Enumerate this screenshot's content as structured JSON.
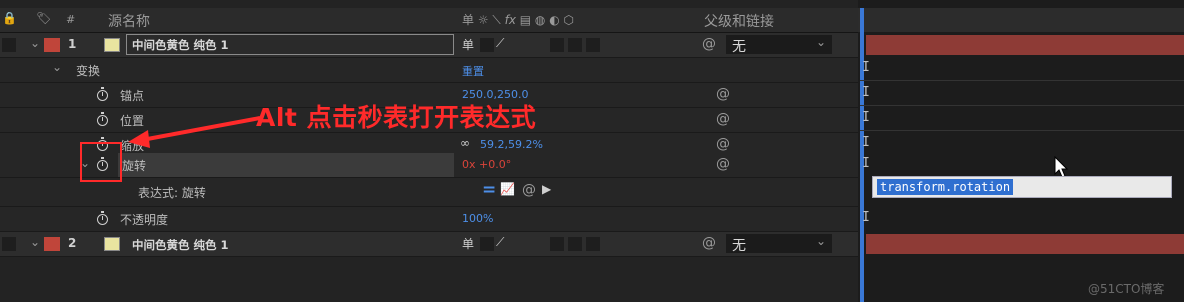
{
  "header": {
    "num_col": "#",
    "source_name_col": "源名称",
    "parent_col": "父级和链接"
  },
  "layers": [
    {
      "index": "1",
      "name": "中间色黄色 纯色 1",
      "parent_value": "无",
      "switch_solo": "单"
    },
    {
      "index": "2",
      "name": "中间色黄色 纯色 1",
      "parent_value": "无",
      "switch_solo": "单"
    }
  ],
  "transform": {
    "label": "变换",
    "reset": "重置",
    "anchor": {
      "label": "锚点",
      "value": "250.0,250.0"
    },
    "position": {
      "label": "位置",
      "value": ""
    },
    "scale": {
      "label": "缩放",
      "value": "59.2,59.2%"
    },
    "rotation": {
      "label": "旋转",
      "value": "0x +0.0°"
    },
    "expression": {
      "label": "表达式: 旋转"
    },
    "opacity": {
      "label": "不透明度",
      "value": "100%"
    }
  },
  "expression_field": {
    "text": "transform.rotation"
  },
  "annotation": {
    "text": "Alt 点击秒表打开表达式"
  },
  "watermark": "@51CTO博客",
  "colors": {
    "annotation": "#ff2a2a",
    "layer_label": "#c0453a",
    "solid_swatch": "#e9e4a0",
    "value_blue": "#4d8fe8",
    "bar": "#8e3b36"
  }
}
